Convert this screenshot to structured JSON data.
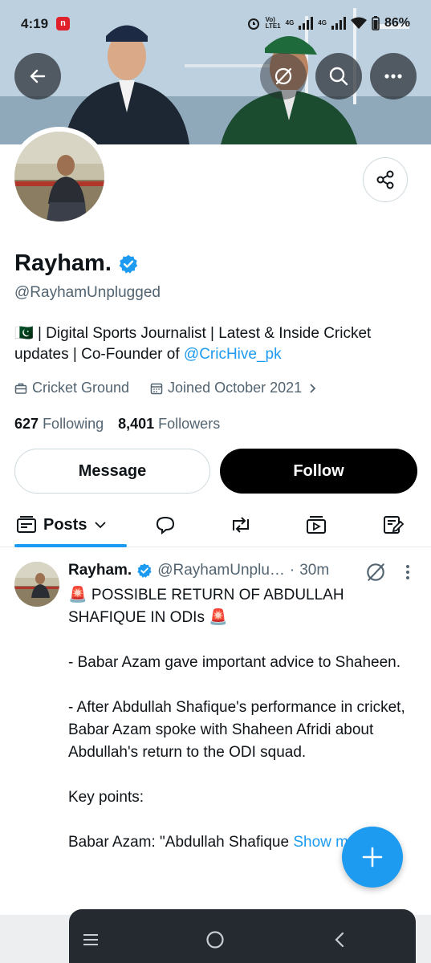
{
  "statusbar": {
    "time": "4:19",
    "notification_badge": "n",
    "volte": "Vo)",
    "lte": "LTE1",
    "sig1": "4G",
    "sig2": "4G",
    "battery": "86%"
  },
  "header": {
    "back_icon": "arrow-left-icon",
    "grok_icon": "grok-icon",
    "search_icon": "search-icon",
    "more_icon": "more-horizontal-icon"
  },
  "profile": {
    "name": "Rayham.",
    "verified": true,
    "handle": "@RayhamUnplugged",
    "bio_flag": "🇵🇰",
    "bio_text": " | Digital Sports Journalist | Latest & Inside Cricket updates | Co-Founder of ",
    "bio_link": "@CricHive_pk",
    "location": "Cricket Ground",
    "joined": "Joined October 2021",
    "following_count": "627",
    "following_label": "Following",
    "followers_count": "8,401",
    "followers_label": "Followers",
    "message_label": "Message",
    "follow_label": "Follow"
  },
  "tabs": {
    "posts_label": "Posts",
    "icons": [
      "replies-icon",
      "retweets-icon",
      "media-icon",
      "articles-icon"
    ]
  },
  "tweet": {
    "name": "Rayham.",
    "handle": "@RayhamUnplu…",
    "separator": "·",
    "time": "30m",
    "lines": [
      "🚨 POSSIBLE RETURN OF ABDULLAH SHAFIQUE IN ODIs 🚨",
      "",
      "- Babar Azam gave important advice to Shaheen.",
      "",
      "- After Abdullah Shafique's performance in cricket, Babar Azam spoke with Shaheen Afridi about Abdullah's return to the ODI squad.",
      "",
      "Key points:",
      ""
    ],
    "last_line": "Babar Azam: \"Abdullah Shafique ",
    "show_more": "Show more"
  },
  "colors": {
    "accent": "#1d9bf0",
    "text": "#0f1419",
    "secondary": "#536471",
    "follow_bg": "#000000"
  }
}
